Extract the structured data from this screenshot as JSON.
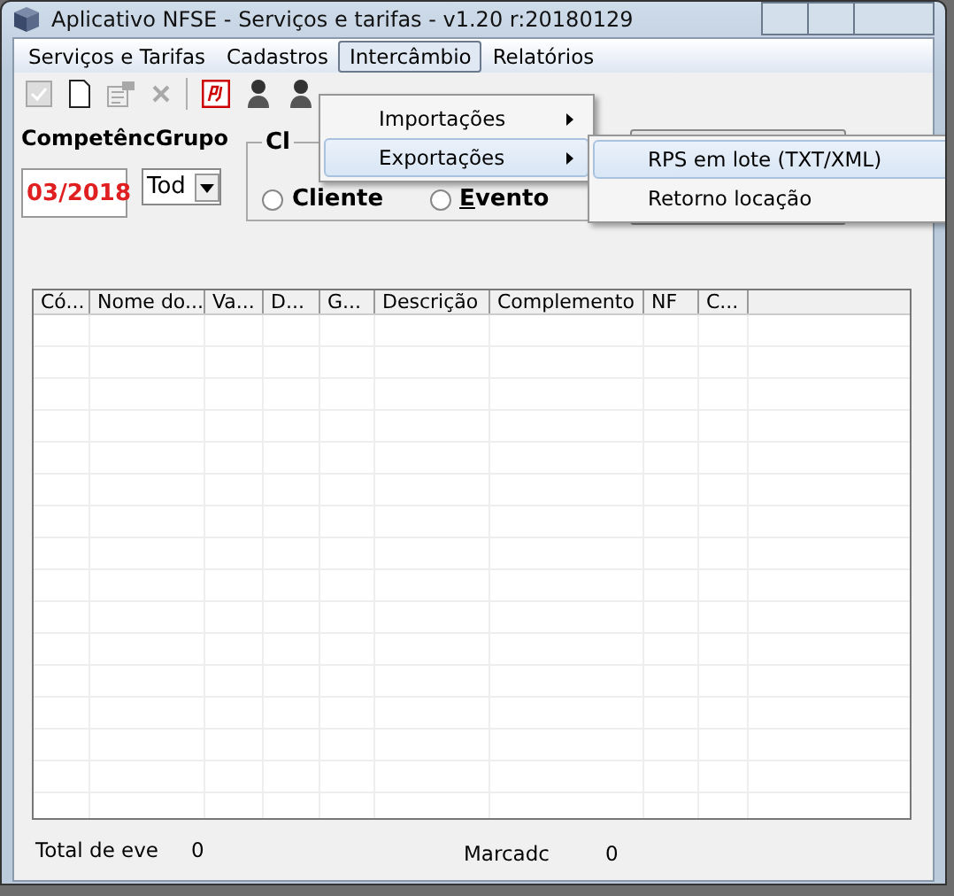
{
  "window": {
    "title": "Aplicativo NFSE - Serviços e tarifas - v1.20 r:20180129"
  },
  "menu": [
    {
      "label": "Serviços e Tarifas",
      "selected": false
    },
    {
      "label": "Cadastros",
      "selected": false
    },
    {
      "label": "Intercâmbio",
      "selected": true
    },
    {
      "label": "Relatórios",
      "selected": false
    }
  ],
  "dropdown": [
    {
      "label": "Importações",
      "selected": false,
      "has_submenu": true
    },
    {
      "label": "Exportações",
      "selected": true,
      "has_submenu": true
    }
  ],
  "submenu": [
    {
      "label": "RPS em lote (TXT/XML)",
      "selected": true
    },
    {
      "label": "Retorno locação",
      "selected": false
    }
  ],
  "toolbar": [
    {
      "kind": "check",
      "disabled": true
    },
    {
      "kind": "new",
      "disabled": false
    },
    {
      "kind": "properties",
      "disabled": true
    },
    {
      "kind": "delete",
      "disabled": true
    },
    {
      "kind": "separator"
    },
    {
      "kind": "pj",
      "disabled": false
    },
    {
      "kind": "figure",
      "disabled": false
    },
    {
      "kind": "figure",
      "disabled": false
    }
  ],
  "filters": {
    "competencia_label": "Competênc",
    "grupo_label": "Grupo",
    "competencia_value": "03/2018",
    "grupo_value": "Tod",
    "group_title": "Cl",
    "radios": [
      {
        "label": "Cliente",
        "selected": false,
        "mnemonic": false
      },
      {
        "label": "Evento",
        "selected": false,
        "mnemonic": true
      }
    ]
  },
  "grid": {
    "columns": [
      "Có...",
      "Nome do...",
      "Va...",
      "D...",
      "G...",
      "Descrição",
      "Complemento",
      "NF",
      "C..."
    ]
  },
  "footer": {
    "total_label": "Total de eve",
    "total_value": "0",
    "marked_label": "Marcadc",
    "marked_value": "0"
  }
}
